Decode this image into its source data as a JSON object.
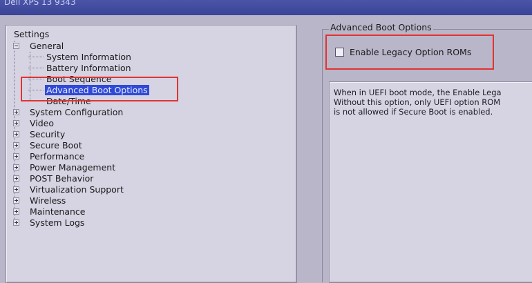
{
  "window": {
    "title": "Dell XPS 13 9343"
  },
  "tree": {
    "root_label": "Settings",
    "general": {
      "label": "General",
      "children": [
        "System Information",
        "Battery Information",
        "Boot Sequence",
        "Advanced Boot Options",
        "Date/Time"
      ]
    },
    "groups": [
      "System Configuration",
      "Video",
      "Security",
      "Secure Boot",
      "Performance",
      "Power Management",
      "POST Behavior",
      "Virtualization Support",
      "Wireless",
      "Maintenance",
      "System Logs"
    ],
    "selected": "Advanced Boot Options"
  },
  "detail": {
    "group_title": "Advanced Boot Options",
    "option_label": "Enable Legacy Option ROMs",
    "option_checked": false,
    "description_lines": [
      "When in UEFI boot mode, the Enable Lega",
      "Without this option, only UEFI option ROM",
      "is not allowed if Secure Boot is enabled."
    ]
  },
  "colors": {
    "background": "#b9b6c9",
    "selection": "#2f4ad6",
    "annotation": "#e2322f"
  }
}
